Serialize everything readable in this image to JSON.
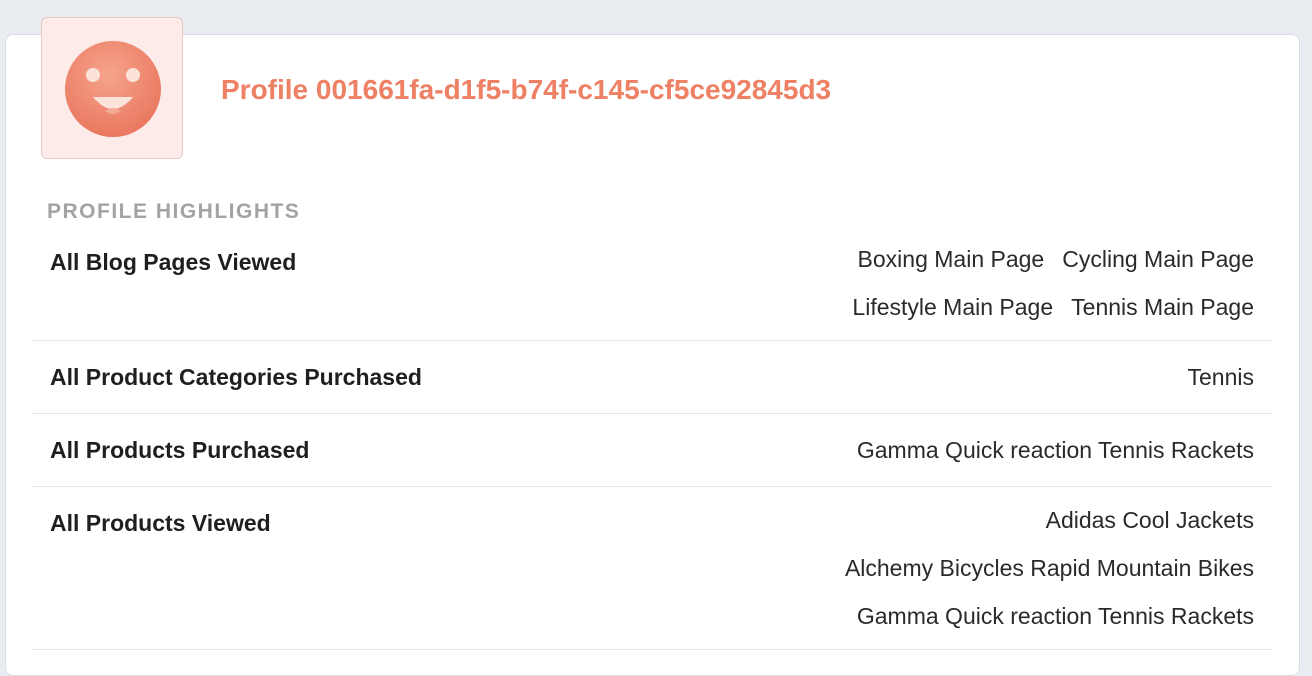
{
  "header": {
    "profile_title": "Profile 001661fa-d1f5-b74f-c145-cf5ce92845d3",
    "avatar_icon": "smiley-face-icon",
    "accent_color": "#ee8064"
  },
  "highlights": {
    "section_label": "PROFILE HIGHLIGHTS",
    "rows": [
      {
        "label": "All Blog Pages Viewed",
        "value_lines": [
          [
            "Boxing Main Page",
            "Cycling Main Page"
          ],
          [
            "Lifestyle Main Page",
            "Tennis Main Page"
          ]
        ]
      },
      {
        "label": "All Product Categories Purchased",
        "value_lines": [
          [
            "Tennis"
          ]
        ]
      },
      {
        "label": "All Products Purchased",
        "value_lines": [
          [
            "Gamma Quick reaction Tennis Rackets"
          ]
        ]
      },
      {
        "label": "All Products Viewed",
        "value_lines": [
          [
            "Adidas Cool Jackets"
          ],
          [
            "Alchemy Bicycles Rapid Mountain Bikes"
          ],
          [
            "Gamma Quick reaction Tennis Rackets"
          ]
        ]
      }
    ]
  }
}
